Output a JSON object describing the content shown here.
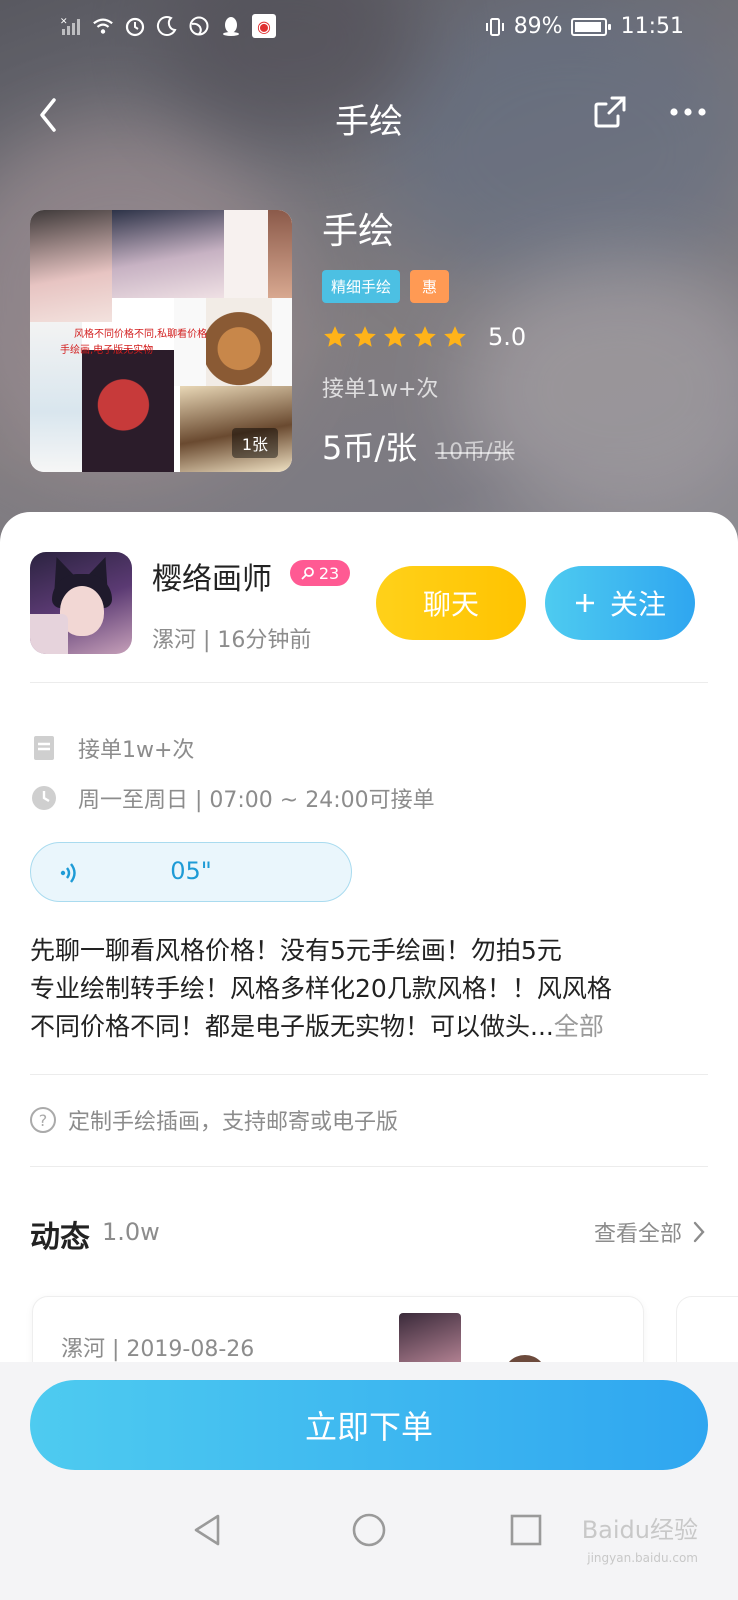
{
  "status_bar": {
    "battery_level": "89%",
    "time": "11:51",
    "icons": [
      "no-sim-icon",
      "wifi-icon",
      "alarm-icon",
      "moon-icon",
      "globe-icon",
      "qq-icon",
      "app-notification-icon",
      "vibrate-icon",
      "battery-icon"
    ]
  },
  "header": {
    "title": "手绘"
  },
  "product": {
    "name": "手绘",
    "tags": [
      "精细手绘",
      "惠"
    ],
    "rating": "5.0",
    "stars": 5,
    "orders": "接单1w+次",
    "price": "5币/张",
    "original_price": "10币/张",
    "image_count": "1张"
  },
  "seller": {
    "name": "樱络画师",
    "level": "23",
    "location_time": "漯河 | 16分钟前",
    "chat_label": "聊天",
    "follow_label": "关注"
  },
  "info": {
    "orders": "接单1w+次",
    "schedule": "周一至周日 | 07:00 ~ 24:00可接单"
  },
  "voice": {
    "duration": "05\""
  },
  "description": {
    "line1": "先聊一聊看风格价格！没有5元手绘画！勿拍5元",
    "line2": "专业绘制转手绘！风格多样化20几款风格！！风风格",
    "line3": "不同价格不同！都是电子版无实物！可以做头...",
    "more_label": "全部"
  },
  "note": "定制手绘插画，支持邮寄或电子版",
  "feed": {
    "title": "动态",
    "count": "1.0w",
    "view_all": "查看全部",
    "items": [
      {
        "meta": "漯河 | 2019-08-26"
      }
    ]
  },
  "cta": {
    "order_label": "立即下单"
  },
  "watermark": {
    "line1": "Baidu经验",
    "line2": "jingyan.baidu.com"
  },
  "colors": {
    "accent_blue": "#2fa6f0",
    "chat_yellow": "#ffc300",
    "star": "#ffb319",
    "tag_blue": "#4cc0e3",
    "tag_orange": "#ff9a54",
    "level_pink": "#ff5a93"
  }
}
